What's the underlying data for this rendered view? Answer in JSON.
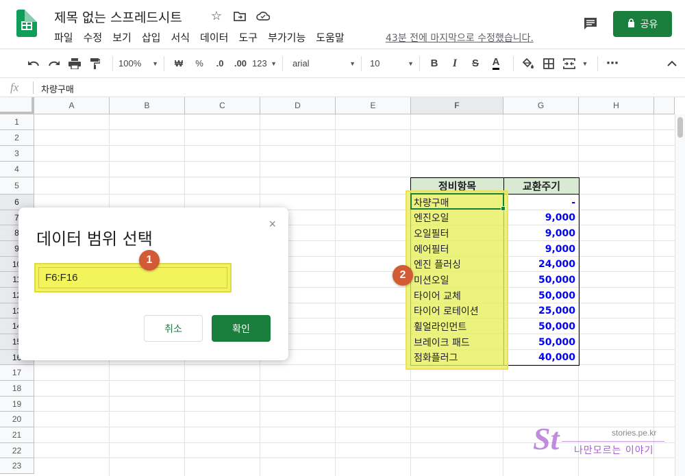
{
  "header": {
    "doc_title": "제목 없는 스프레드시트",
    "menu": [
      "파일",
      "수정",
      "보기",
      "삽입",
      "서식",
      "데이터",
      "도구",
      "부가기능",
      "도움말"
    ],
    "last_edit": "43분 전에 마지막으로 수정했습니다.",
    "share_label": "공유",
    "brand_color": "#1a7f3c"
  },
  "toolbar": {
    "zoom": "100%",
    "currency": "₩",
    "percent": "%",
    "dec_decrease": ".0",
    "dec_increase": ".00",
    "format_more": "123",
    "font": "arial",
    "font_size": "10",
    "bold": "B",
    "italic": "I",
    "strike": "S",
    "text_color": "A",
    "more": "⋯"
  },
  "formula_bar": {
    "fx": "fx",
    "value": "차량구매"
  },
  "columns": [
    "A",
    "B",
    "C",
    "D",
    "E",
    "F",
    "G",
    "H"
  ],
  "rows": [
    "1",
    "2",
    "3",
    "4",
    "5",
    "6",
    "7",
    "8",
    "9",
    "10",
    "11",
    "12",
    "13",
    "14",
    "15",
    "16",
    "17",
    "18",
    "19",
    "20",
    "21",
    "22",
    "23"
  ],
  "table": {
    "header_item": "정비항목",
    "header_cycle": "교환주기",
    "header_bg": "#d9ead3",
    "value_color": "#0000ff",
    "rows": [
      {
        "item": "차량구매",
        "cycle": "-"
      },
      {
        "item": "엔진오일",
        "cycle": "9,000"
      },
      {
        "item": "오일필터",
        "cycle": "9,000"
      },
      {
        "item": "에어필터",
        "cycle": "9,000"
      },
      {
        "item": "엔진 플러싱",
        "cycle": "24,000"
      },
      {
        "item": "미션오일",
        "cycle": "50,000"
      },
      {
        "item": "타이어 교체",
        "cycle": "50,000"
      },
      {
        "item": "타이어 로테이션",
        "cycle": "25,000"
      },
      {
        "item": "휠얼라인먼트",
        "cycle": "50,000"
      },
      {
        "item": "브레이크 패드",
        "cycle": "50,000"
      },
      {
        "item": "점화플러그",
        "cycle": "40,000"
      }
    ]
  },
  "dialog": {
    "title": "데이터 범위 선택",
    "range": "F6:F16",
    "cancel": "취소",
    "ok": "확인",
    "close": "×"
  },
  "badges": [
    "1",
    "2"
  ],
  "watermark": {
    "logo": "St",
    "url": "stories.pe.kr",
    "tagline": "나만모르는 이야기"
  }
}
